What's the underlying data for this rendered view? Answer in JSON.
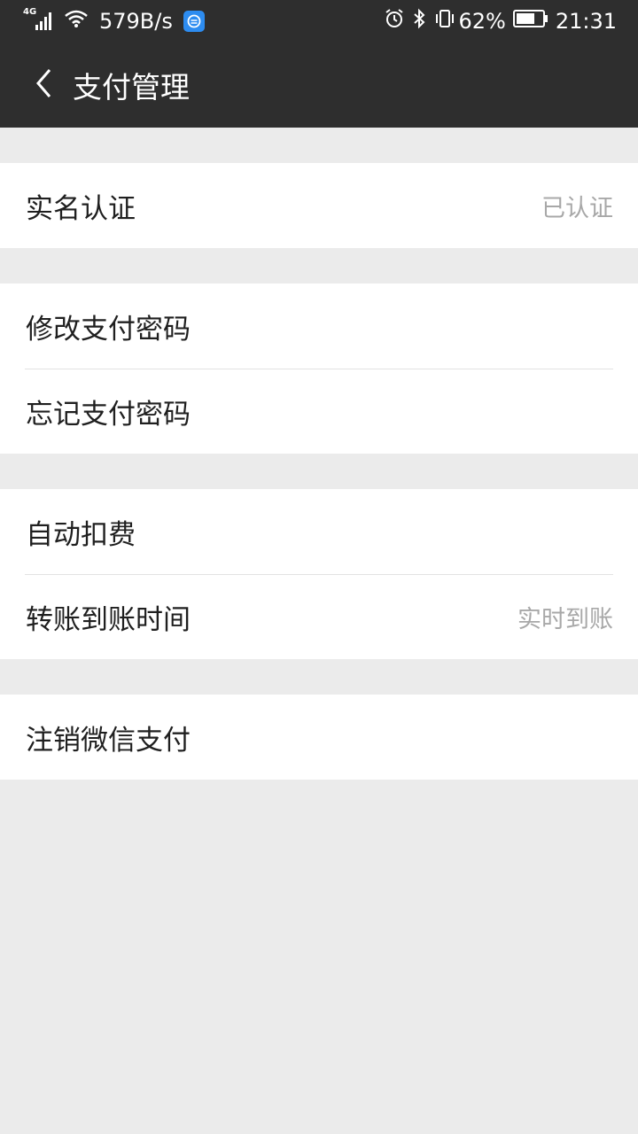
{
  "status_bar": {
    "network_type": "4G",
    "speed": "579B/s",
    "battery_percent": "62%",
    "time": "21:31"
  },
  "nav": {
    "title": "支付管理"
  },
  "groups": [
    [
      {
        "label": "实名认证",
        "value": "已认证"
      }
    ],
    [
      {
        "label": "修改支付密码"
      },
      {
        "label": "忘记支付密码"
      }
    ],
    [
      {
        "label": "自动扣费"
      },
      {
        "label": "转账到账时间",
        "value": "实时到账"
      }
    ],
    [
      {
        "label": "注销微信支付"
      }
    ]
  ],
  "colors": {
    "header_bg": "#2e2e2e",
    "page_bg": "#ebebeb",
    "row_bg": "#ffffff",
    "value_text": "#a8a8a8"
  }
}
